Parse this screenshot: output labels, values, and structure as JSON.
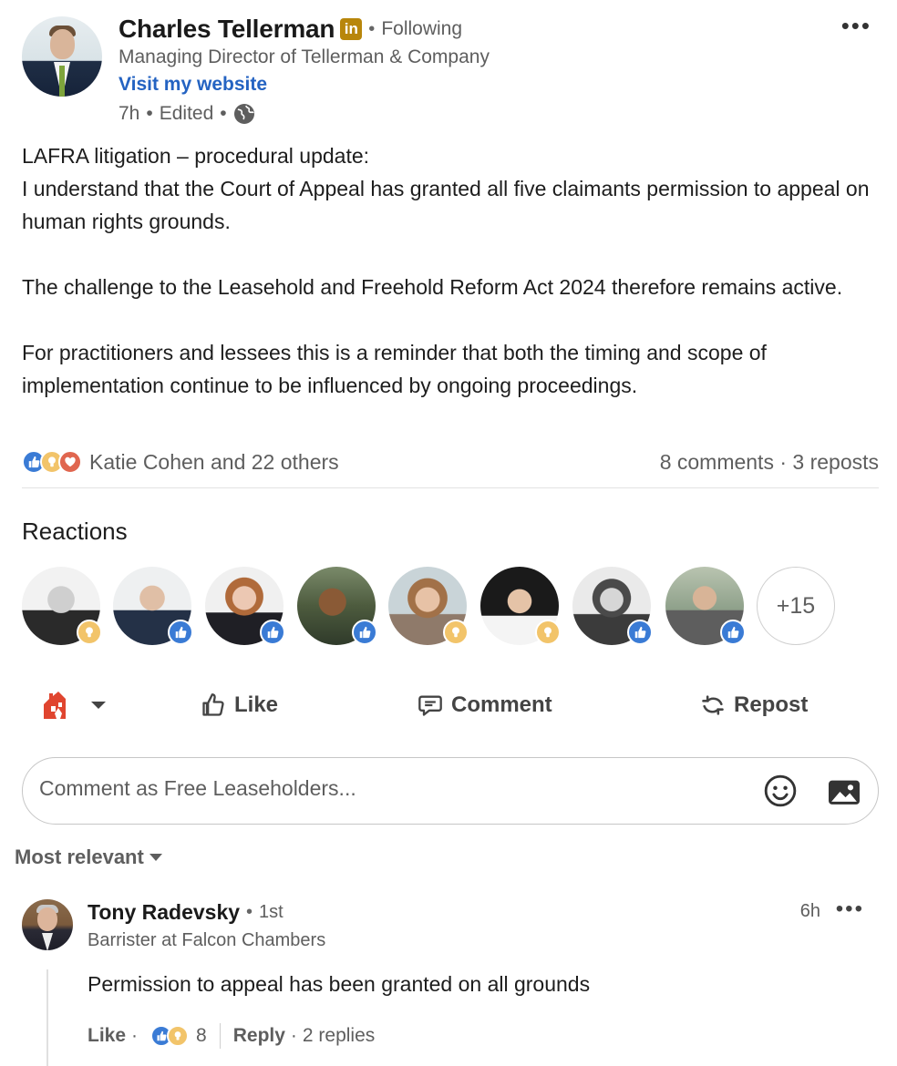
{
  "post": {
    "author": {
      "name": "Charles Tellerman",
      "badge": "in",
      "relationship": "Following",
      "headline": "Managing Director of Tellerman & Company",
      "website_link": "Visit my website",
      "time": "7h",
      "edited": "Edited"
    },
    "body": [
      "LAFRA litigation – procedural update:\nI understand that the Court of Appeal has granted all five claimants permission to appeal on human rights grounds.",
      "The challenge to the Leasehold and Freehold Reform Act 2024 therefore remains active.",
      "For practitioners and lessees this is a reminder that both the timing and scope of implementation continue to be influenced by ongoing proceedings."
    ],
    "reaction_summary": "Katie Cohen and 22 others",
    "comments_reposts": "8 comments · 3 reposts"
  },
  "reactions": {
    "title": "Reactions",
    "more": "+15",
    "people": [
      {
        "reaction": "insightful"
      },
      {
        "reaction": "like"
      },
      {
        "reaction": "like"
      },
      {
        "reaction": "like"
      },
      {
        "reaction": "insightful"
      },
      {
        "reaction": "insightful"
      },
      {
        "reaction": "like"
      },
      {
        "reaction": "like"
      }
    ]
  },
  "actions": {
    "like": "Like",
    "comment": "Comment",
    "repost": "Repost"
  },
  "comment_box": {
    "placeholder": "Comment as Free Leaseholders..."
  },
  "sort": {
    "label": "Most relevant"
  },
  "comment": {
    "name": "Tony Radevsky",
    "degree": "1st",
    "headline": "Barrister at Falcon Chambers",
    "time": "6h",
    "text": "Permission to appeal has been granted on all grounds",
    "like_label": "Like",
    "reaction_count": "8",
    "reply_label": "Reply",
    "replies": "2 replies"
  },
  "colors": {
    "link": "#2463c2",
    "like": "#3a7bd5",
    "insightful": "#f2c46a",
    "love": "#e0664f",
    "brand_badge": "#b8860b"
  }
}
